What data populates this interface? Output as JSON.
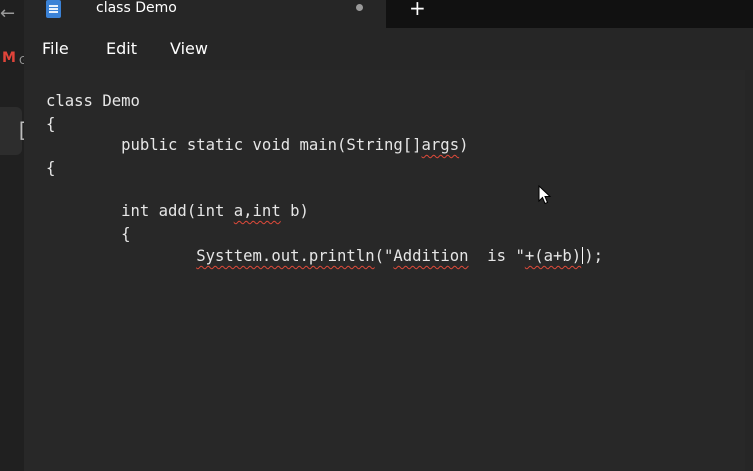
{
  "browser": {
    "back_glyph": "←",
    "gmail_glyph": "M",
    "gmail_partial_label": "G"
  },
  "tab": {
    "title": "class Demo",
    "new_tab_glyph": "+"
  },
  "menu": {
    "file": "File",
    "edit": "Edit",
    "view": "View"
  },
  "code": {
    "line1": "class Demo",
    "line2": "{",
    "line3_a": "        public static void main(String[]",
    "line3_b": "args",
    "line3_c": ")",
    "line4": "{",
    "line5_a": "        int add(int ",
    "line5_b": "a,int",
    "line5_c": " b)",
    "line6": "        {",
    "line7_a": "                ",
    "line7_b": "Systtem.out.println",
    "line7_c": "(\"",
    "line7_d": "Addition",
    "line7_e": "  is \"",
    "line7_f": "+(a+b)",
    "line7_g": ");"
  }
}
